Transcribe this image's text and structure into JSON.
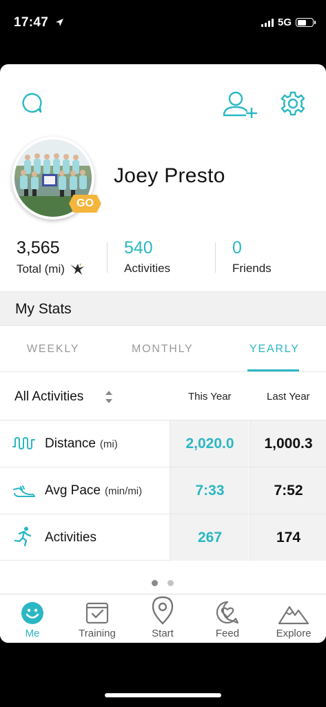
{
  "status_bar": {
    "time": "17:47",
    "network": "5G",
    "battery_level": 0.58
  },
  "header": {
    "icons": [
      "chat-icon",
      "add-friend-icon",
      "gear-icon"
    ]
  },
  "profile": {
    "name": "Joey Presto",
    "badge": "GO",
    "stats": {
      "total_value": "3,565",
      "total_label": "Total (mi)",
      "activities_value": "540",
      "activities_label": "Activities",
      "friends_value": "0",
      "friends_label": "Friends"
    }
  },
  "my_stats": {
    "title": "My Stats",
    "tabs": {
      "weekly": "WEEKLY",
      "monthly": "MONTHLY",
      "yearly": "YEARLY",
      "selected": "YEARLY"
    },
    "filter": "All Activities",
    "columns": {
      "this": "This Year",
      "last": "Last Year"
    },
    "rows": [
      {
        "label": "Distance",
        "unit": "(mi)",
        "this": "2,020.0",
        "last": "1,000.3",
        "icon": "distance-icon"
      },
      {
        "label": "Avg Pace",
        "unit": "(min/mi)",
        "this": "7:33",
        "last": "7:52",
        "icon": "shoe-icon"
      },
      {
        "label": "Activities",
        "unit": "",
        "this": "267",
        "last": "174",
        "icon": "runner-icon"
      }
    ],
    "page_indicator": {
      "pages": 2,
      "current": 1
    }
  },
  "tabbar": {
    "me": "Me",
    "training": "Training",
    "start": "Start",
    "feed": "Feed",
    "explore": "Explore",
    "selected": "Me"
  },
  "colors": {
    "accent": "#2ab7c4",
    "badge": "#f4b53d"
  }
}
